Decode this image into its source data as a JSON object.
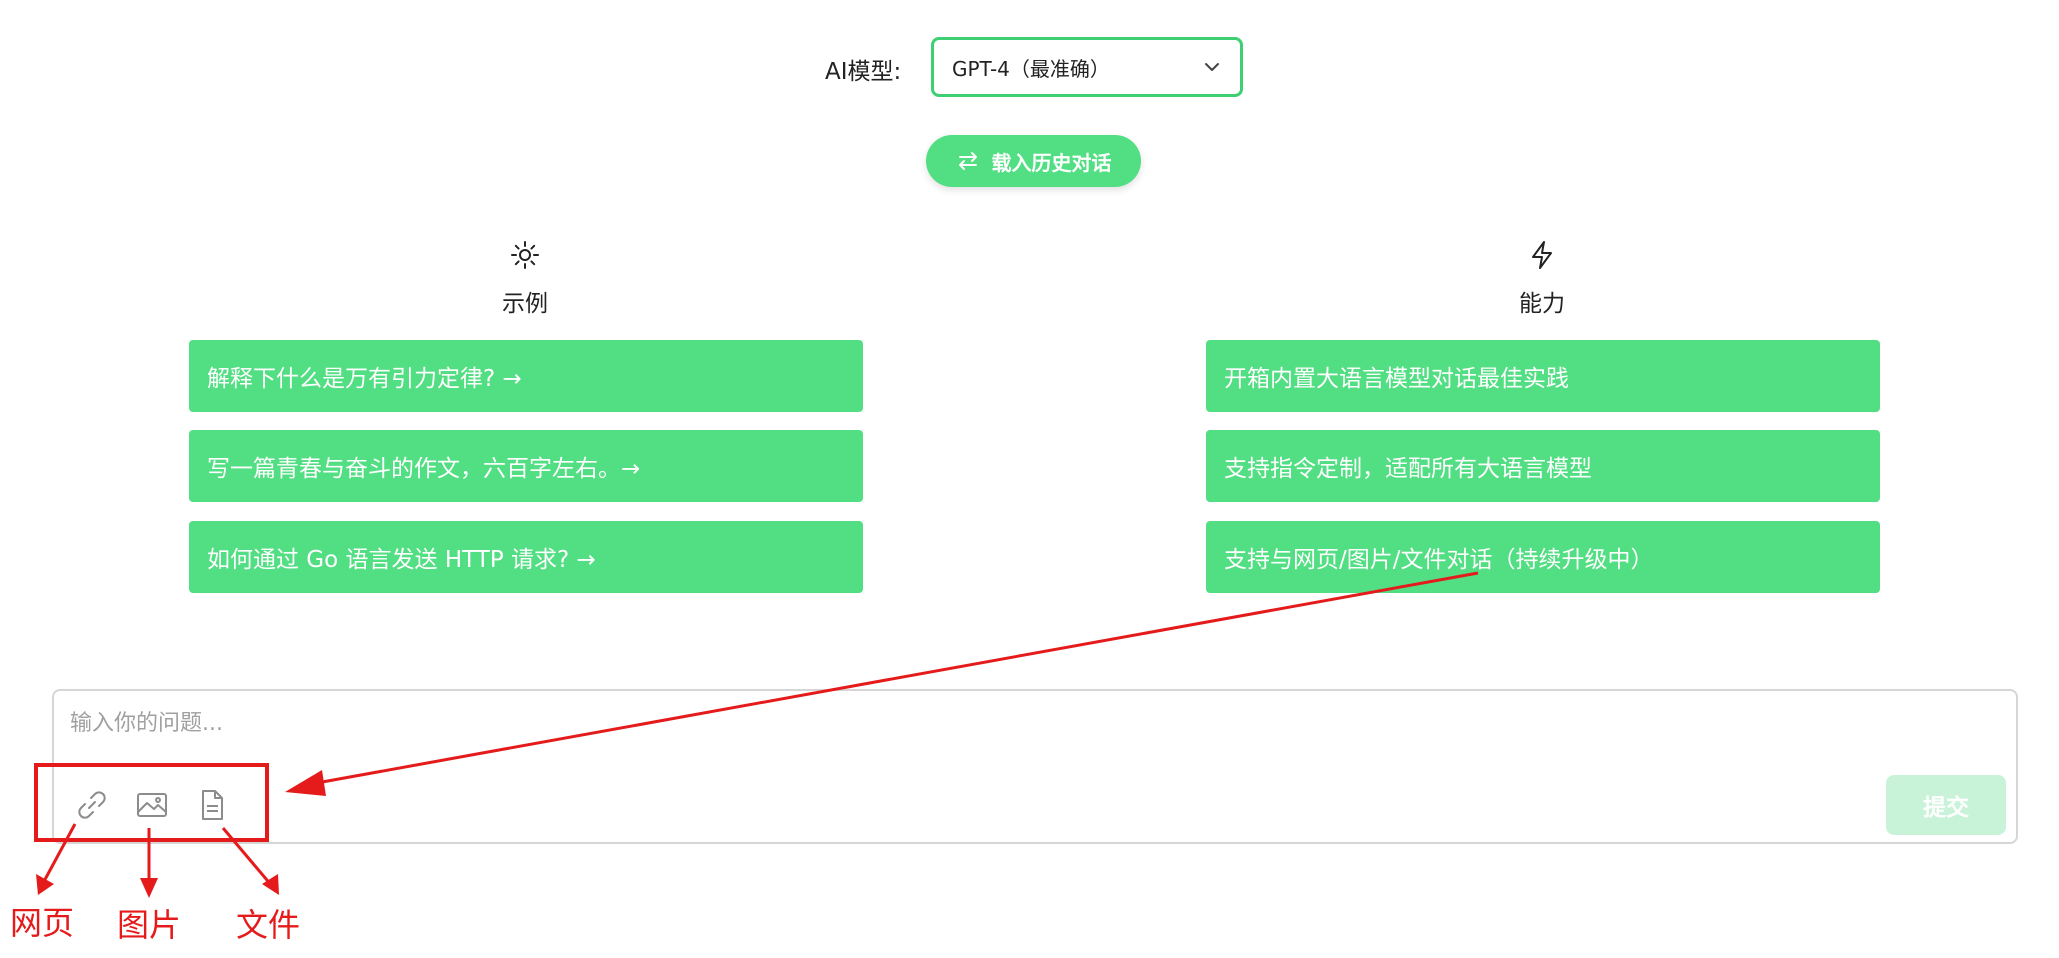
{
  "header": {
    "model_label": "AI模型:",
    "model_selected": "GPT-4（最准确）",
    "history_button": "载入历史对话"
  },
  "columns": [
    {
      "icon": "sun-icon",
      "title": "示例",
      "cards": [
        "解释下什么是万有引力定律? →",
        "写一篇青春与奋斗的作文，六百字左右。→",
        "如何通过 Go 语言发送 HTTP 请求? →"
      ]
    },
    {
      "icon": "lightning-icon",
      "title": "能力",
      "cards": [
        "开箱内置大语言模型对话最佳实践",
        "支持指令定制，适配所有大语言模型",
        "支持与网页/图片/文件对话（持续升级中）"
      ]
    }
  ],
  "composer": {
    "placeholder": "输入你的问题...",
    "tools": [
      "link-icon",
      "image-icon",
      "file-icon"
    ],
    "submit_label": "提交"
  },
  "annotations": {
    "labels": [
      "网页",
      "图片",
      "文件"
    ],
    "color": "#e51b1b"
  },
  "colors": {
    "accent": "#52de82",
    "submit_disabled": "#c9f3d8",
    "select_border": "#3ecf72"
  }
}
